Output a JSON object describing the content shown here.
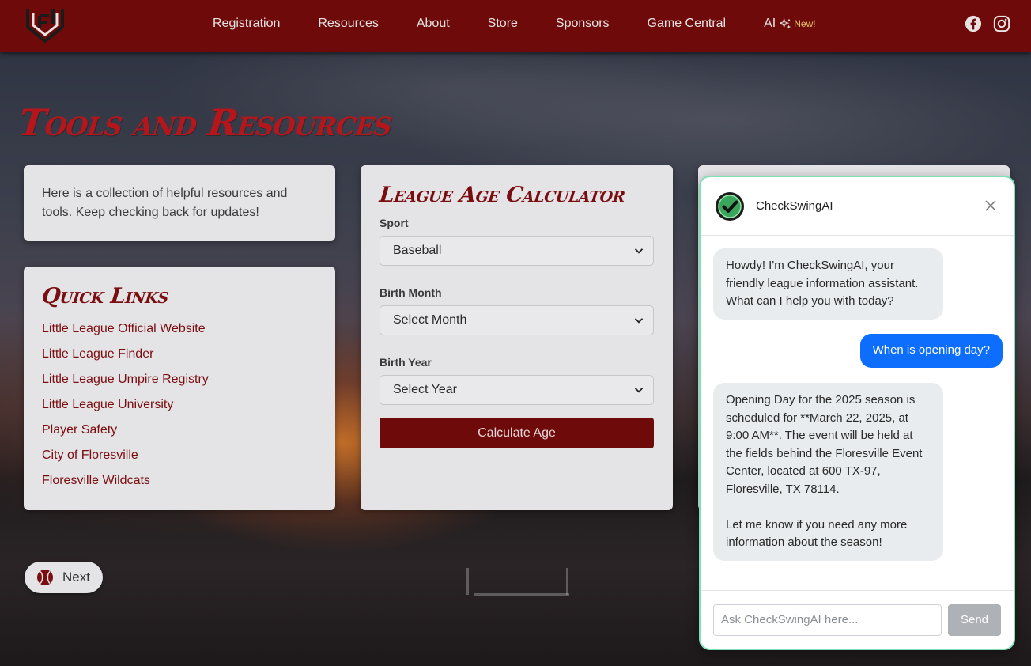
{
  "colors": {
    "nav_bg": "#6e0a0a",
    "title_red": "#b5161b",
    "link_red": "#7a0d10",
    "card_bg": "#e4e4e6",
    "chat_border": "#7fe0b4",
    "user_bubble": "#0d6efd",
    "bot_bubble": "#e9ecef"
  },
  "nav": {
    "logo_icon": "league-logo-icon",
    "links": [
      "Registration",
      "Resources",
      "About",
      "Store",
      "Sponsors",
      "Game Central"
    ],
    "ai_label": "AI",
    "ai_badge": "New!",
    "social": [
      "facebook-icon",
      "instagram-icon"
    ]
  },
  "page": {
    "title": "Tools and Resources"
  },
  "intro": {
    "text": "Here is a collection of helpful resources and tools. Keep checking back for updates!"
  },
  "quick_links": {
    "heading": "Quick Links",
    "items": [
      "Little League Official Website",
      "Little League Finder",
      "Little League Umpire Registry",
      "Little League University",
      "Player Safety",
      "City of Floresville",
      "Floresville Wildcats"
    ]
  },
  "calculator": {
    "heading": "League Age Calculator",
    "sport_label": "Sport",
    "sport_value": "Baseball",
    "month_label": "Birth Month",
    "month_value": "Select Month",
    "year_label": "Birth Year",
    "year_value": "Select Year",
    "button": "Calculate Age"
  },
  "next_button": {
    "label": "Next"
  },
  "chat": {
    "name": "CheckSwingAI",
    "messages": [
      {
        "role": "bot",
        "text": "Howdy! I'm CheckSwingAI, your friendly league information assistant. What can I help you with today?"
      },
      {
        "role": "user",
        "text": "When is opening day?"
      },
      {
        "role": "bot",
        "text": "Opening Day for the 2025 season is scheduled for **March 22, 2025, at 9:00 AM**. The event will be held at the fields behind the Floresville Event Center, located at 600 TX-97, Floresville, TX 78114.\n\nLet me know if you need any more information about the season!"
      }
    ],
    "input_placeholder": "Ask CheckSwingAI here...",
    "send_label": "Send"
  }
}
